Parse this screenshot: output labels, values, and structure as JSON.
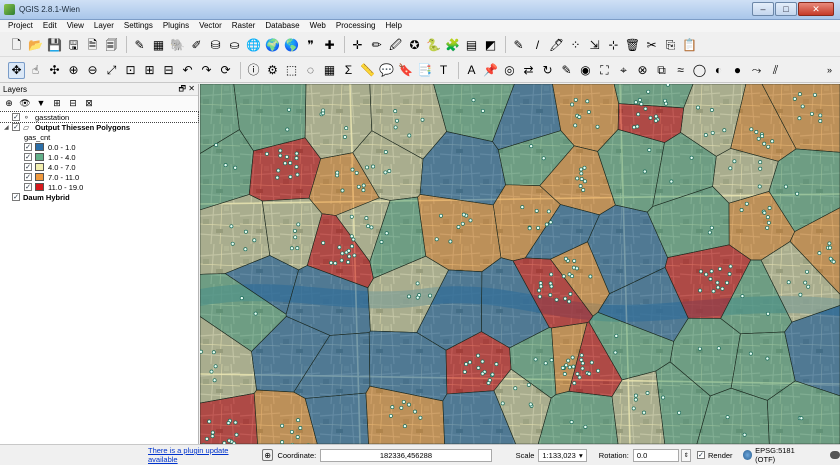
{
  "window": {
    "title": "QGIS 2.8.1-Wien",
    "minimize": "–",
    "maximize": "□",
    "close": "✕"
  },
  "menu": [
    "Project",
    "Edit",
    "View",
    "Layer",
    "Settings",
    "Plugins",
    "Vector",
    "Raster",
    "Database",
    "Web",
    "Processing",
    "Help"
  ],
  "toolbar1": [
    {
      "name": "new-project-icon",
      "glyph": "🗋"
    },
    {
      "name": "open-project-icon",
      "glyph": "📂"
    },
    {
      "name": "save-project-icon",
      "glyph": "💾"
    },
    {
      "name": "save-as-icon",
      "glyph": "🖫"
    },
    {
      "name": "new-print-composer-icon",
      "glyph": "🗎"
    },
    {
      "name": "composer-manager-icon",
      "glyph": "🗐"
    },
    {
      "sep": true
    },
    {
      "name": "add-vector-layer-icon",
      "glyph": "✎"
    },
    {
      "name": "add-raster-layer-icon",
      "glyph": "▦"
    },
    {
      "name": "add-postgis-layer-icon",
      "glyph": "🐘"
    },
    {
      "name": "add-spatialite-layer-icon",
      "glyph": "✐"
    },
    {
      "name": "add-mssql-layer-icon",
      "glyph": "⛁"
    },
    {
      "name": "add-oracle-layer-icon",
      "glyph": "⛀"
    },
    {
      "name": "add-wms-layer-icon",
      "glyph": "🌐"
    },
    {
      "name": "add-wcs-layer-icon",
      "glyph": "🌍"
    },
    {
      "name": "add-wfs-layer-icon",
      "glyph": "🌎"
    },
    {
      "name": "add-delimited-text-icon",
      "glyph": "❞"
    },
    {
      "name": "new-shapefile-icon",
      "glyph": "✚"
    },
    {
      "sep": true
    },
    {
      "name": "georeferencer-icon",
      "glyph": "✛"
    },
    {
      "name": "digitize-icon",
      "glyph": "✏"
    },
    {
      "name": "save-edits-icon",
      "glyph": "🖉"
    },
    {
      "name": "add-feature-icon",
      "glyph": "✪"
    },
    {
      "name": "python-console-icon",
      "glyph": "🐍"
    },
    {
      "name": "plugin-manager-icon",
      "glyph": "🧩"
    },
    {
      "name": "field-calculator-icon",
      "glyph": "▤"
    },
    {
      "name": "styles-icon",
      "glyph": "◩"
    },
    {
      "sep": true
    },
    {
      "name": "pencil-icon",
      "glyph": "✎"
    },
    {
      "name": "edit-icon",
      "glyph": "/"
    },
    {
      "name": "toggle-editing-icon",
      "glyph": "🖊"
    },
    {
      "name": "vertex-tool-icon",
      "glyph": "⁘"
    },
    {
      "name": "move-feature-icon",
      "glyph": "⇲"
    },
    {
      "name": "node-tool-icon",
      "glyph": "⊹"
    },
    {
      "name": "delete-selected-icon",
      "glyph": "🗑"
    },
    {
      "name": "cut-features-icon",
      "glyph": "✂"
    },
    {
      "name": "copy-features-icon",
      "glyph": "⎘"
    },
    {
      "name": "paste-features-icon",
      "glyph": "📋"
    }
  ],
  "toolbar2": [
    {
      "name": "pan-map-icon",
      "glyph": "✥",
      "active": true
    },
    {
      "name": "touch-zoom-icon",
      "glyph": "☝"
    },
    {
      "name": "pan-to-selection-icon",
      "glyph": "✣"
    },
    {
      "name": "zoom-in-icon",
      "glyph": "⊕"
    },
    {
      "name": "zoom-out-icon",
      "glyph": "⊖"
    },
    {
      "name": "zoom-full-icon",
      "glyph": "⤢"
    },
    {
      "name": "zoom-selection-icon",
      "glyph": "⊡"
    },
    {
      "name": "zoom-layer-icon",
      "glyph": "⊞"
    },
    {
      "name": "zoom-native-icon",
      "glyph": "⊟"
    },
    {
      "name": "zoom-last-icon",
      "glyph": "↶"
    },
    {
      "name": "zoom-next-icon",
      "glyph": "↷"
    },
    {
      "name": "refresh-icon",
      "glyph": "⟳"
    },
    {
      "sep": true
    },
    {
      "name": "identify-icon",
      "glyph": "ⓘ"
    },
    {
      "name": "action-icon",
      "glyph": "⚙"
    },
    {
      "name": "select-features-icon",
      "glyph": "⬚"
    },
    {
      "name": "deselect-icon",
      "glyph": "◌"
    },
    {
      "name": "open-attribute-table-icon",
      "glyph": "▦"
    },
    {
      "name": "statistics-icon",
      "glyph": "Σ"
    },
    {
      "name": "measure-line-icon",
      "glyph": "📏"
    },
    {
      "name": "map-tips-icon",
      "glyph": "💬"
    },
    {
      "name": "new-bookmark-icon",
      "glyph": "🔖"
    },
    {
      "name": "show-bookmarks-icon",
      "glyph": "📑"
    },
    {
      "name": "text-annotation-icon",
      "glyph": "T"
    },
    {
      "sep": true
    },
    {
      "name": "label-tool-icon",
      "glyph": "A"
    },
    {
      "name": "pin-labels-icon",
      "glyph": "📌"
    },
    {
      "name": "show-hide-labels-icon",
      "glyph": "◎"
    },
    {
      "name": "move-label-icon",
      "glyph": "⇄"
    },
    {
      "name": "rotate-label-icon",
      "glyph": "↻"
    },
    {
      "name": "change-label-icon",
      "glyph": "✎"
    },
    {
      "name": "highlight-pinned-icon",
      "glyph": "◉"
    },
    {
      "name": "offline-editing-icon",
      "glyph": "⛶"
    },
    {
      "name": "advanced-digitizing-icon",
      "glyph": "⌖"
    },
    {
      "name": "snapping-icon",
      "glyph": "⊗"
    },
    {
      "name": "topology-checker-icon",
      "glyph": "⧉"
    },
    {
      "name": "simplify-icon",
      "glyph": "≈"
    },
    {
      "name": "add-ring-icon",
      "glyph": "◯"
    },
    {
      "name": "add-part-icon",
      "glyph": "◐"
    },
    {
      "name": "fill-ring-icon",
      "glyph": "●"
    },
    {
      "name": "reshape-icon",
      "glyph": "⤳"
    },
    {
      "name": "split-features-icon",
      "glyph": "⫽"
    }
  ],
  "layers_panel": {
    "title": "Layers",
    "controls": "🗗 ✕",
    "tools": [
      {
        "name": "add-group-icon",
        "glyph": "⊕"
      },
      {
        "name": "manage-visibility-icon",
        "glyph": "👁"
      },
      {
        "name": "filter-legend-icon",
        "glyph": "▼"
      },
      {
        "name": "expand-all-icon",
        "glyph": "⊞"
      },
      {
        "name": "collapse-all-icon",
        "glyph": "⊟"
      },
      {
        "name": "remove-layer-icon",
        "glyph": "⊠"
      }
    ],
    "layers": {
      "gasstation": "gasstation",
      "thiessen": "Output Thiessen Polygons",
      "attribute": "gas_cnt",
      "daum": "Daum Hybrid"
    },
    "classes": [
      {
        "label": "0.0 - 1.0",
        "color": "#2c6fa8"
      },
      {
        "label": "1.0 - 4.0",
        "color": "#63b08a"
      },
      {
        "label": "4.0 - 7.0",
        "color": "#f3efb0"
      },
      {
        "label": "7.0 - 11.0",
        "color": "#f0993e"
      },
      {
        "label": "11.0 - 19.0",
        "color": "#d7191c"
      }
    ]
  },
  "statusbar": {
    "plugin_message": "There is a plugin update available",
    "coordinate_label": "Coordinate:",
    "coordinate_value": "182336,456288",
    "scale_label": "Scale",
    "scale_value": "1:133,023",
    "rotation_label": "Rotation:",
    "rotation_value": "0.0",
    "render_label": "Render",
    "crs_label": "EPSG:5181 (OTF)"
  }
}
